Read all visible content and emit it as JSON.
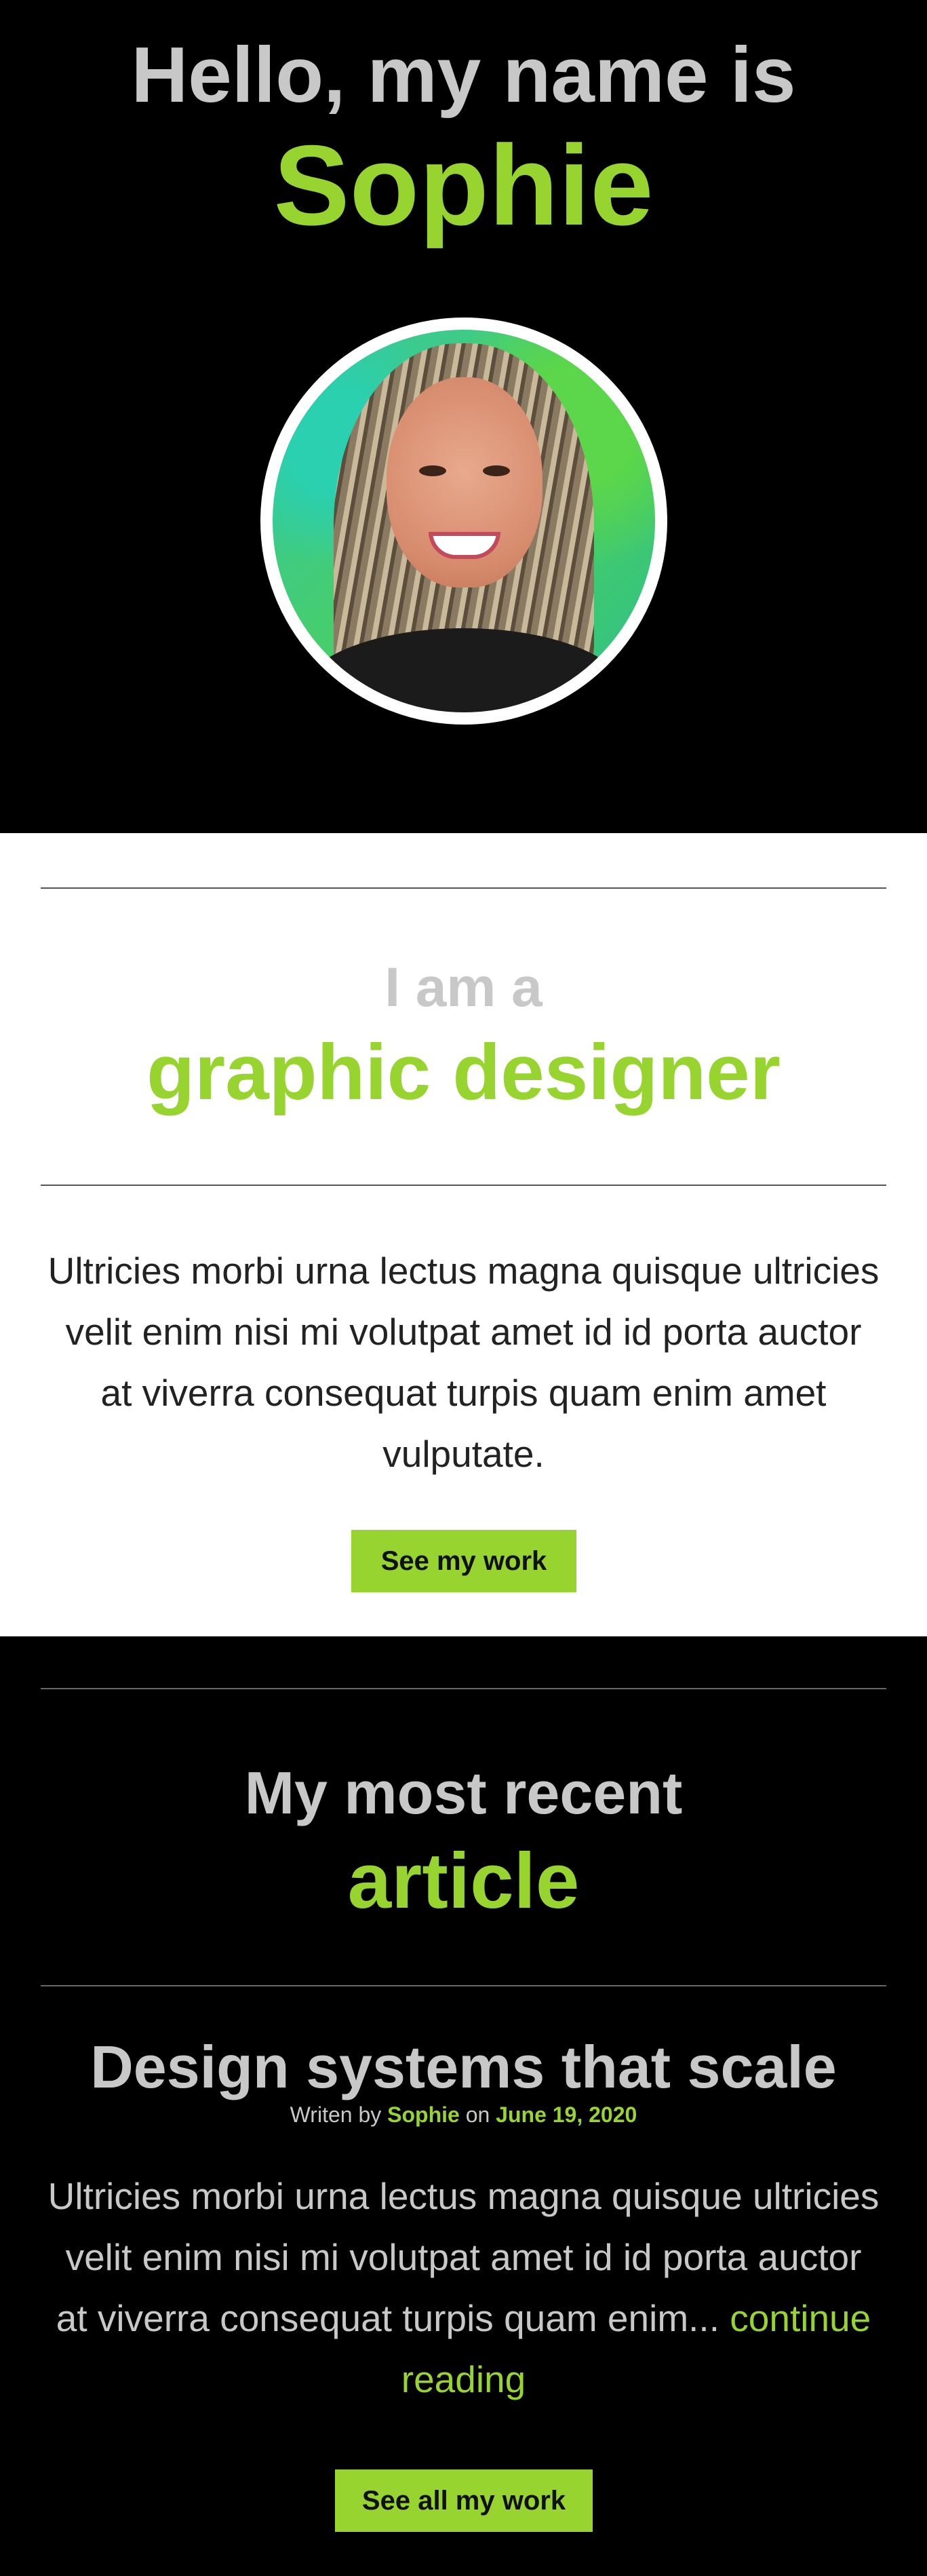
{
  "hero": {
    "greeting": "Hello, my name is",
    "name": "Sophie"
  },
  "designer": {
    "kicker": "I am a",
    "title": "graphic designer",
    "copy": "Ultricies morbi urna lectus magna quisque ultricies velit enim nisi mi volutpat amet id id porta auctor at viverra consequat turpis quam enim amet vulputate.",
    "button_label": "See my work"
  },
  "article": {
    "kicker": "My most recent",
    "title": "article",
    "post": {
      "title": "Design systems that scale",
      "meta_prefix": "Writen by",
      "author": "Sophie",
      "meta_on": "on",
      "date": "June 19, 2020",
      "excerpt": "Ultricies morbi urna lectus magna quisque ultricies velit enim nisi mi volutpat amet id id porta auctor at viverra consequat turpis quam enim...",
      "continue_label": "continue reading"
    },
    "button_label": "See all my work"
  },
  "colors": {
    "accent": "#97d42f",
    "muted": "#c8c8c8",
    "dark_bg": "#000000",
    "light_bg": "#ffffff"
  }
}
